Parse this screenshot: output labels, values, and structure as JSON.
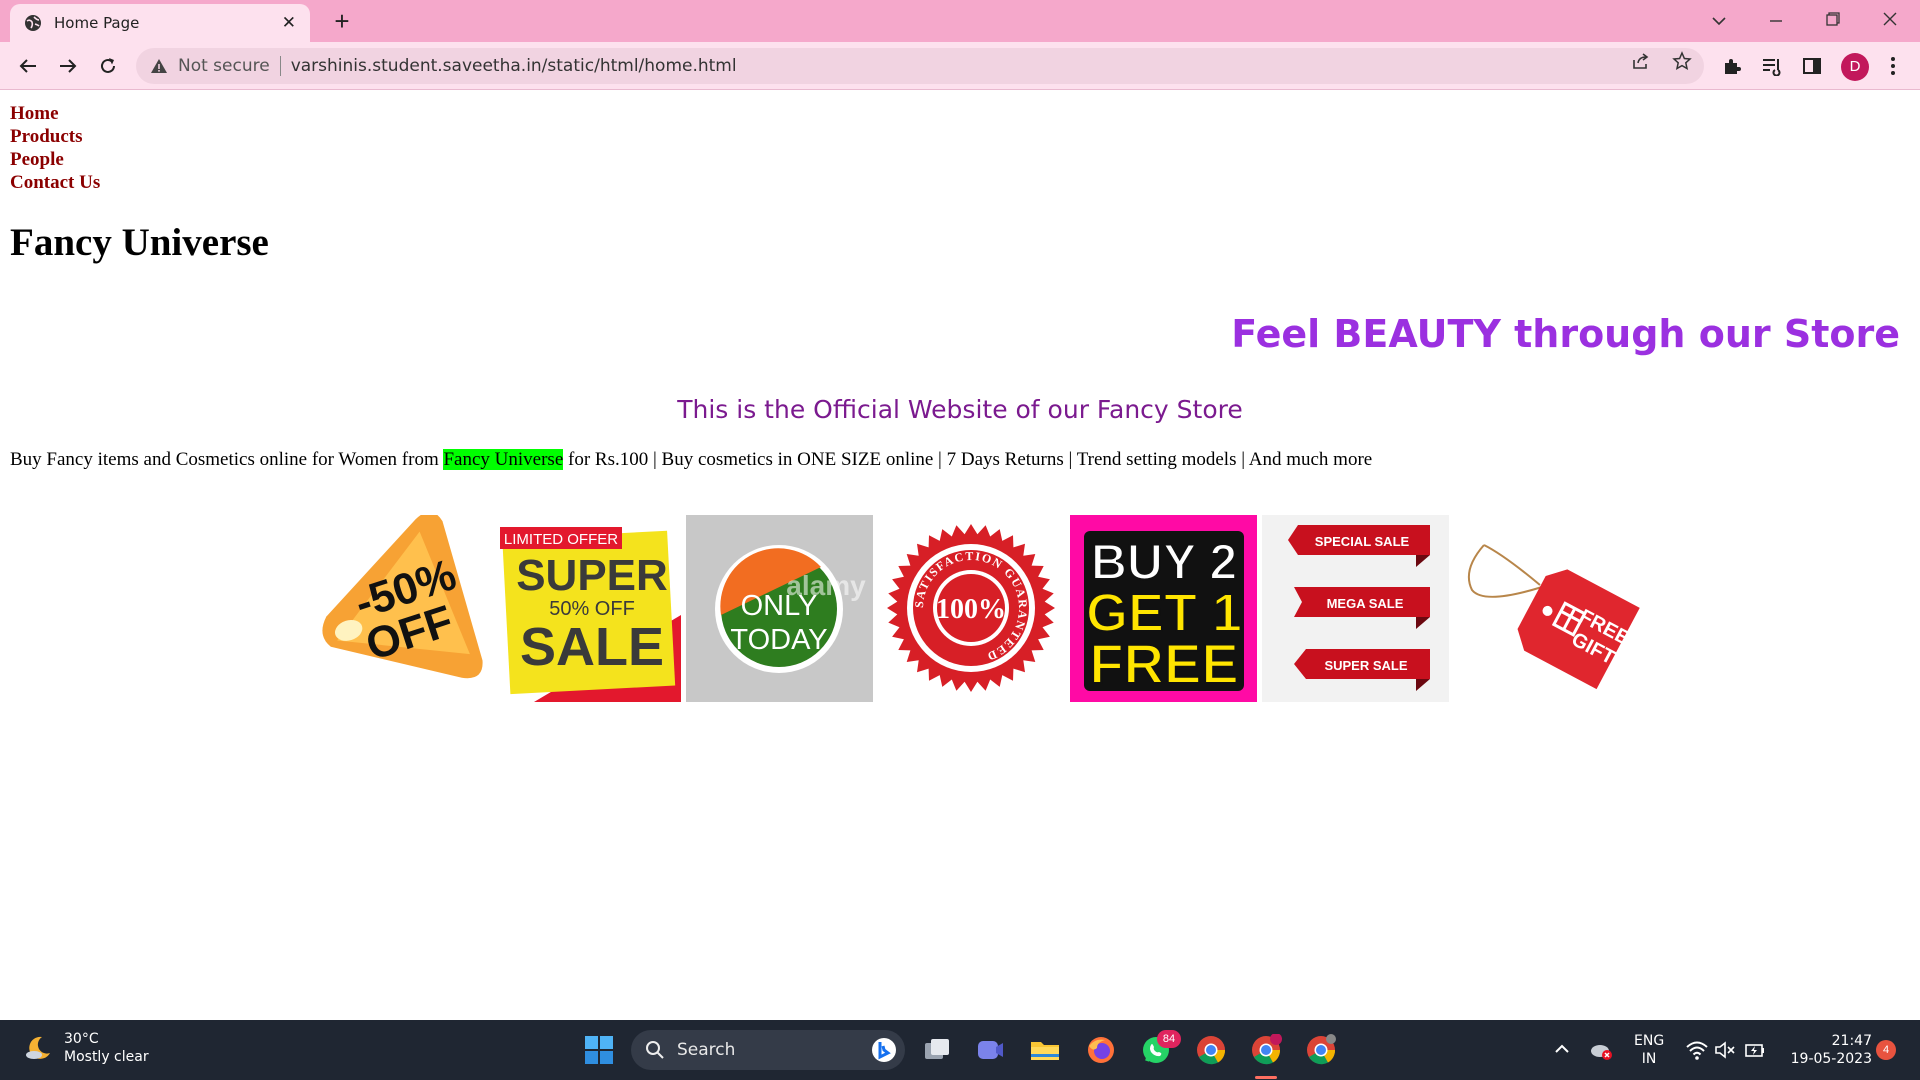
{
  "browser": {
    "tab_title": "Home Page",
    "tab_close": "✕",
    "new_tab": "+",
    "not_secure": "Not secure",
    "url": "varshinis.student.saveetha.in/static/html/home.html",
    "avatar_letter": "D"
  },
  "nav": {
    "links": [
      "Home",
      "Products",
      "People",
      "Contact Us"
    ]
  },
  "page": {
    "heading": "Fancy Universe",
    "tagline": "Feel BEAUTY through our Store",
    "subtitle": "This is the Official Website of our Fancy Store",
    "para_before": "Buy Fancy items and Cosmetics online for Women from ",
    "para_highlight": "Fancy Universe",
    "para_after": " for Rs.100 | Buy cosmetics in ONE SIZE online | 7 Days Returns | Trend setting models | And much more",
    "highlight_color": "#00ff00"
  },
  "gallery": {
    "img1": {
      "line1": "-50%",
      "line2": "OFF"
    },
    "img2": {
      "top": "LIMITED OFFER",
      "line1": "SUPER",
      "line2": "50% OFF",
      "line3": "SALE"
    },
    "img3": {
      "line1": "ONLY",
      "line2": "TODAY",
      "watermark": "alamy"
    },
    "img4": {
      "center": "100%",
      "ring": "SATISFACTION  GUARANTEED"
    },
    "img5": {
      "line1": "BUY 2",
      "line2": "GET 1",
      "line3": "FREE"
    },
    "img6": {
      "r1": "SPECIAL SALE",
      "r2": "MEGA SALE",
      "r3": "SUPER SALE"
    },
    "img7": {
      "line1": "FREE",
      "line2": "GIFT"
    }
  },
  "taskbar": {
    "temperature": "30°C",
    "weather": "Mostly clear",
    "search": "Search",
    "whatsapp_badge": "84",
    "lang1": "ENG",
    "lang2": "IN",
    "time": "21:47",
    "date": "19-05-2023",
    "notif_count": "4"
  }
}
